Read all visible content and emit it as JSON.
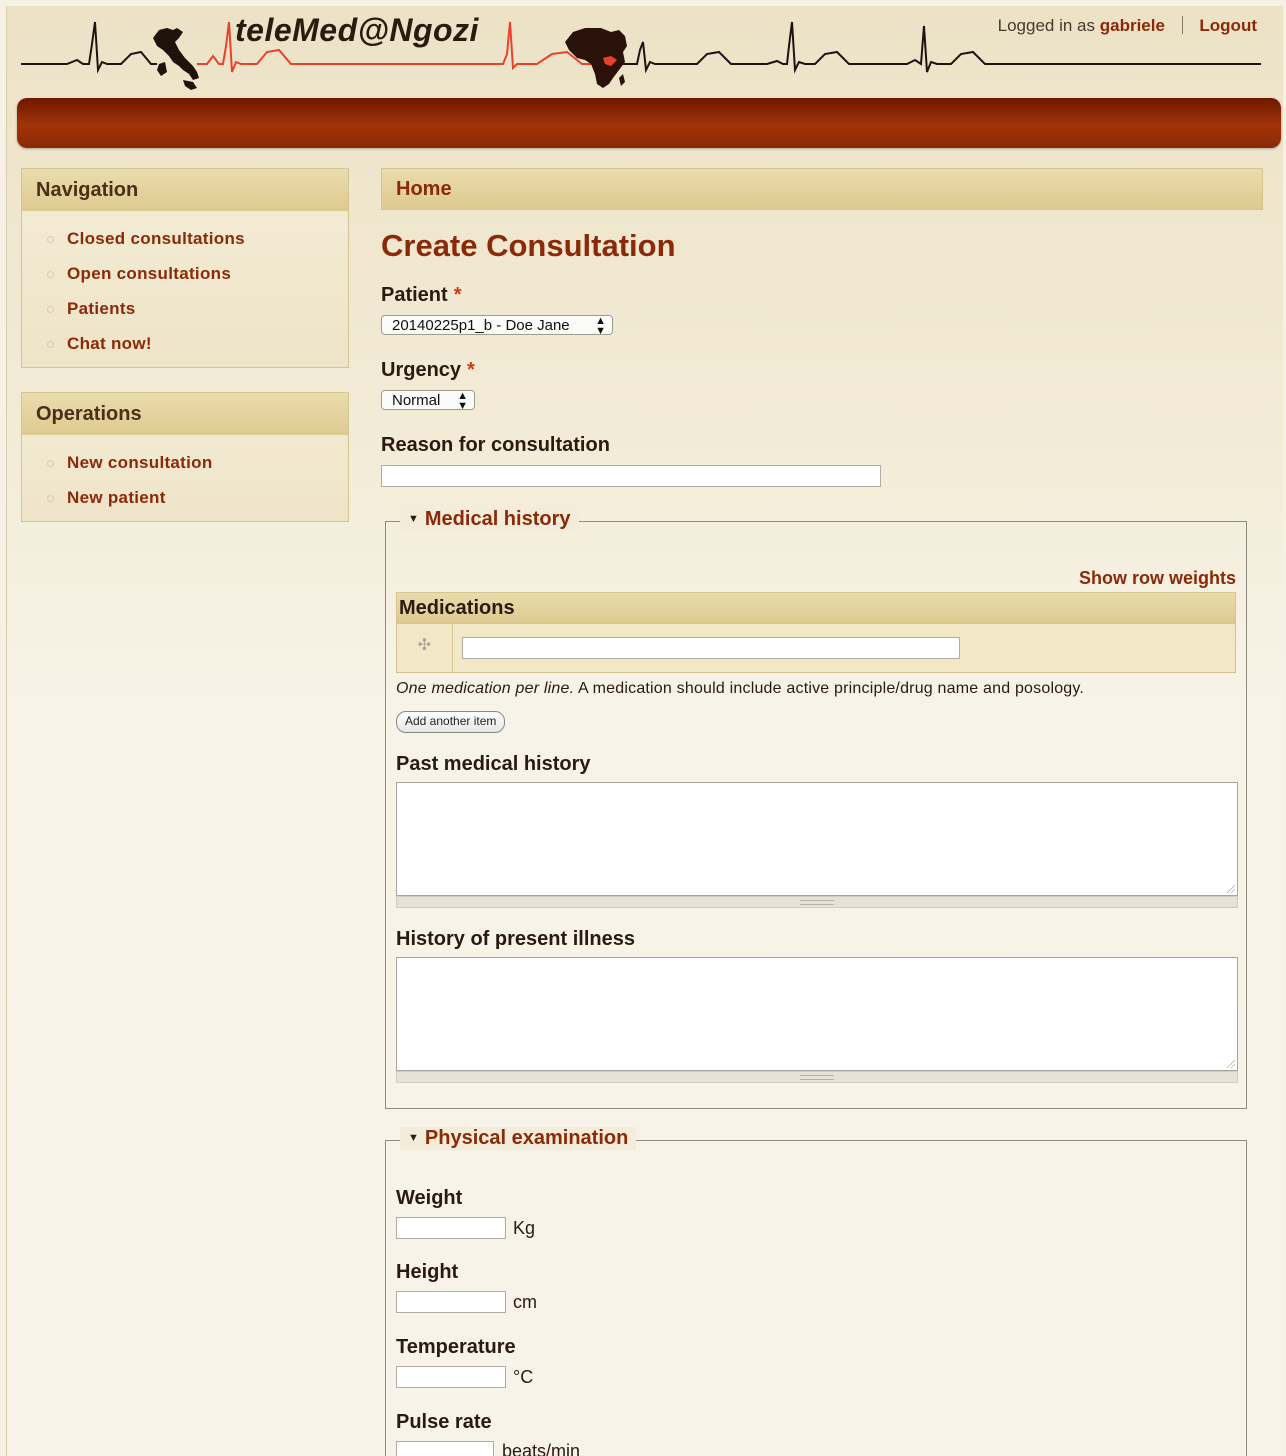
{
  "header": {
    "site_title": "teleMed@Ngozi",
    "logged_in_prefix": "Logged in as",
    "username": "gabriele",
    "logout_label": "Logout"
  },
  "sidebar": {
    "navigation": {
      "title": "Navigation",
      "items": [
        "Closed consultations",
        "Open consultations",
        "Patients",
        "Chat now!"
      ]
    },
    "operations": {
      "title": "Operations",
      "items": [
        "New consultation",
        "New patient"
      ]
    }
  },
  "breadcrumb": {
    "home": "Home"
  },
  "main": {
    "title": "Create Consultation",
    "required_marker": "*",
    "patient": {
      "label": "Patient",
      "selected": "20140225p1_b - Doe Jane"
    },
    "urgency": {
      "label": "Urgency",
      "selected": "Normal"
    },
    "reason": {
      "label": "Reason for consultation",
      "value": ""
    },
    "medical_history": {
      "legend": "Medical history",
      "show_row_weights": "Show row weights",
      "medications_header": "Medications",
      "description_em": "One medication per line.",
      "description_rest": "A medication should include active principle/drug name and posology.",
      "add_item_label": "Add another item",
      "past_history_label": "Past medical history",
      "present_illness_label": "History of present illness"
    },
    "physical_exam": {
      "legend": "Physical examination",
      "weight": {
        "label": "Weight",
        "unit": "Kg"
      },
      "height": {
        "label": "Height",
        "unit": "cm"
      },
      "temperature": {
        "label": "Temperature",
        "unit": "°C"
      },
      "pulse": {
        "label": "Pulse rate",
        "unit": "beats/min"
      }
    }
  },
  "colors": {
    "accent": "#8a2a08",
    "header_bar": "#a2340a",
    "required": "#d23a12",
    "ecg_line": "#e8432a"
  }
}
